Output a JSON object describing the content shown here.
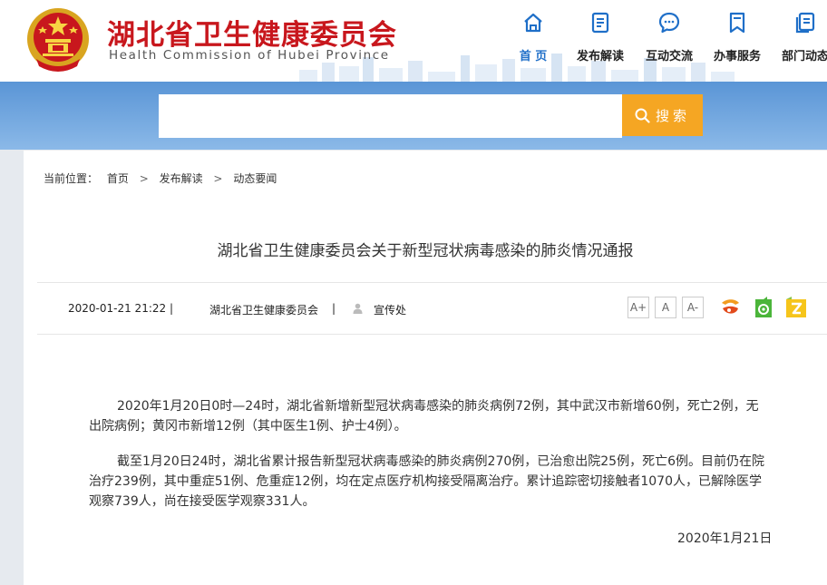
{
  "site": {
    "title": "湖北省卫生健康委员会",
    "subtitle": "Health Commission of Hubei Province"
  },
  "nav": [
    {
      "label": "首 页",
      "icon": "home-icon",
      "active": true
    },
    {
      "label": "发布解读",
      "icon": "document-icon"
    },
    {
      "label": "互动交流",
      "icon": "chat-bubble-icon"
    },
    {
      "label": "办事服务",
      "icon": "bookmark-icon"
    },
    {
      "label": "部门动态",
      "icon": "documents-icon"
    }
  ],
  "search": {
    "button_label": "搜索",
    "value": ""
  },
  "breadcrumb": {
    "prefix": "当前位置：",
    "items": [
      "首页",
      "发布解读",
      "动态要闻"
    ],
    "separator": ">"
  },
  "article": {
    "title": "湖北省卫生健康委员会关于新型冠状病毒感染的肺炎情况通报",
    "date": "2020-01-21 21:22",
    "divider": "|",
    "source": "湖北省卫生健康委员会",
    "author": "宣传处",
    "paragraphs": [
      "2020年1月20日0时—24时，湖北省新增新型冠状病毒感染的肺炎病例72例，其中武汉市新增60例，死亡2例，无出院病例；黄冈市新增12例（其中医生1例、护士4例）。",
      "截至1月20日24时，湖北省累计报告新型冠状病毒感染的肺炎病例270例，已治愈出院25例，死亡6例。目前仍在院治疗239例，其中重症51例、危重症12例，均在定点医疗机构接受隔离治疗。累计追踪密切接触者1070人，已解除医学观察739人，尚在接受医学观察331人。"
    ],
    "signature_date": "2020年1月21日"
  },
  "font_size_buttons": [
    "A+",
    "A",
    "A-"
  ],
  "share_icons": [
    "weibo-icon",
    "wechat-icon",
    "qzone-icon"
  ],
  "colors": {
    "brand_red": "#c8171d",
    "nav_active": "#1f6fc8",
    "search_button": "#f5a623",
    "band": "#6aa2dd"
  }
}
